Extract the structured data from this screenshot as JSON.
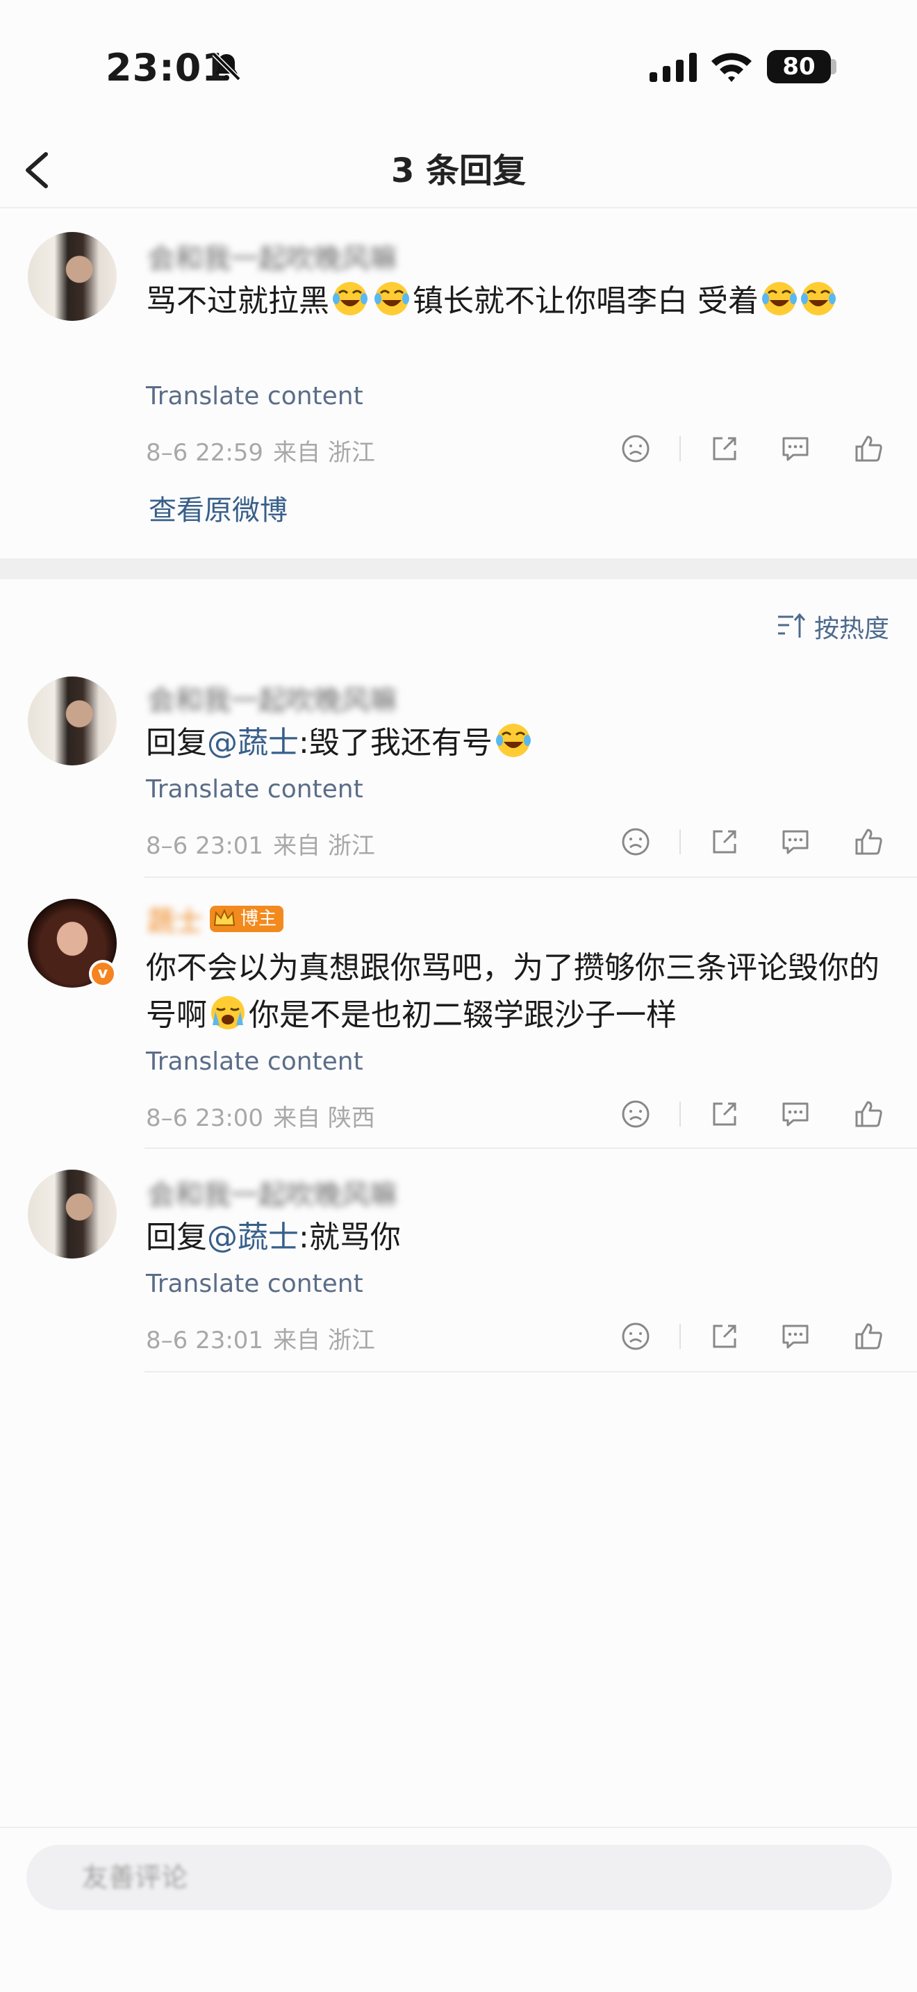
{
  "status_bar": {
    "time": "23:01",
    "battery": "80"
  },
  "nav": {
    "title": "3 条回复"
  },
  "root_comment": {
    "username": "会和我一起吹晚风嘛",
    "text_a": "骂不过就拉黑",
    "text_b": "镇长就不让你唱李白 受着",
    "translate": "Translate content",
    "date": "8–6 22:59",
    "source": "来自 浙江",
    "view_original": "查看原微博"
  },
  "sort": {
    "label": "按热度"
  },
  "replies": [
    {
      "username": "会和我一起吹晚风嘛",
      "prefix": "回复",
      "mention": "@蔬士",
      "text": ":毁了我还有号",
      "translate": "Translate content",
      "date": "8–6 23:01",
      "source": "来自 浙江"
    },
    {
      "username": "蔬士",
      "badge": "博主",
      "text_a": "你不会以为真想跟你骂吧，为了攒够你三条评论毁你的号啊",
      "text_b": "你是不是也初二辍学跟沙子一样",
      "translate": "Translate content",
      "date": "8–6 23:00",
      "source": "来自 陕西"
    },
    {
      "username": "会和我一起吹晚风嘛",
      "prefix": "回复",
      "mention": "@蔬士",
      "text": ":就骂你",
      "translate": "Translate content",
      "date": "8–6 23:01",
      "source": "来自 浙江"
    }
  ],
  "input": {
    "placeholder": "友善评论"
  },
  "icons": [
    "mute-icon",
    "signal-icon",
    "wifi-icon",
    "back-icon",
    "laugh-cry-emoji",
    "sob-emoji",
    "dislike-icon",
    "share-icon",
    "comment-icon",
    "like-icon",
    "sort-icon",
    "crown-icon"
  ],
  "colors": {
    "link": "#385f8a",
    "accent": "#f28a1e",
    "meta": "#a8a8a8"
  }
}
